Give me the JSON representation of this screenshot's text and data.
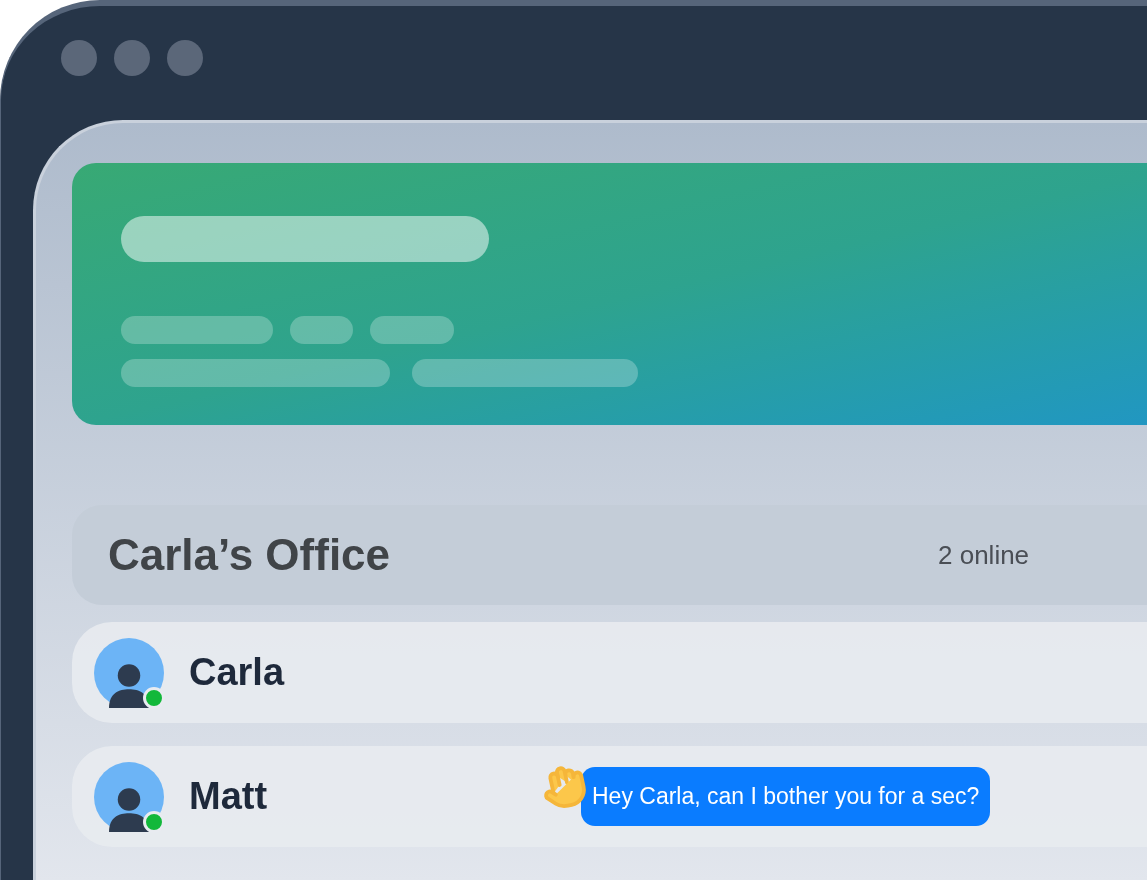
{
  "office": {
    "title": "Carla’s Office",
    "online_count": "2 online"
  },
  "members": [
    {
      "name": "Carla",
      "online": true
    },
    {
      "name": "Matt",
      "online": true,
      "message": "Hey Carla, can I bother you for a sec?"
    }
  ]
}
